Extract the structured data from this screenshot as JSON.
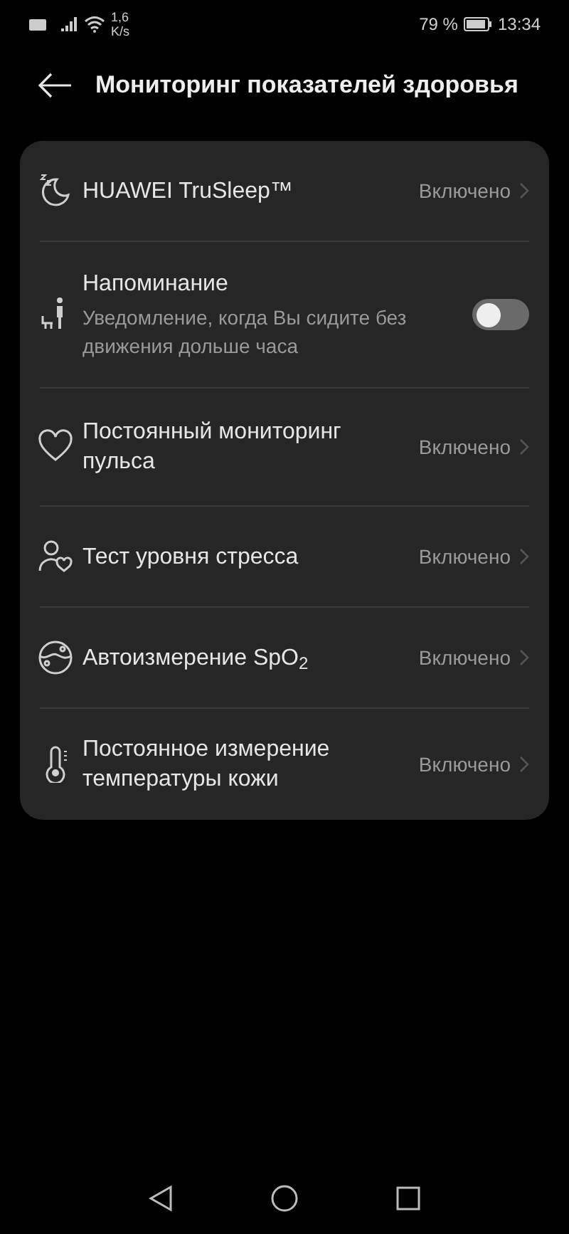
{
  "status_bar": {
    "speed": "1,6",
    "speed_unit": "K/s",
    "battery": "79 %",
    "time": "13:34"
  },
  "header": {
    "title": "Мониторинг показателей здоровья"
  },
  "items": [
    {
      "kind": "link",
      "title": "HUAWEI TruSleep™",
      "value": "Включено"
    },
    {
      "kind": "toggle",
      "title": "Напоминание",
      "subtitle": "Уведомление, когда Вы сидите без движения дольше часа",
      "on": false
    },
    {
      "kind": "link",
      "title": "Постоянный мониторинг пульса",
      "value": "Включено"
    },
    {
      "kind": "link",
      "title": "Тест уровня стресса",
      "value": "Включено"
    },
    {
      "kind": "link",
      "title": "Автоизмерение SpO$_{2}$",
      "value": "Включено"
    },
    {
      "kind": "link",
      "title": "Постоянное измерение температуры кожи",
      "value": "Включено"
    }
  ]
}
